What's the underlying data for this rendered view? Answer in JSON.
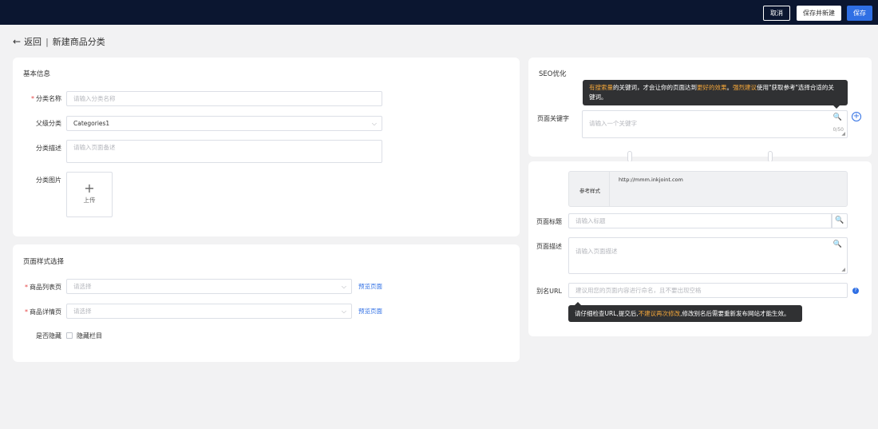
{
  "header": {
    "cancel": "取消",
    "save_new": "保存并新建",
    "save": "保存"
  },
  "nav": {
    "back": "返回",
    "separator": "|",
    "title": "新建商品分类"
  },
  "basic": {
    "title": "基本信息",
    "name_label": "分类名称",
    "name_placeholder": "请输入分类名称",
    "parent_label": "父级分类",
    "parent_value": "Categories1",
    "desc_label": "分类描述",
    "desc_placeholder": "请输入页面备述",
    "image_label": "分类图片",
    "upload_label": "上传"
  },
  "style": {
    "title": "页面样式选择",
    "list_label": "商品列表页",
    "list_placeholder": "请选择",
    "detail_label": "商品详情页",
    "detail_placeholder": "请选择",
    "preview_link": "预览页面",
    "hidden_label": "是否隐藏",
    "hidden_checkbox_label": "隐藏栏目"
  },
  "seo": {
    "title": "SEO优化",
    "tooltip": {
      "p1": "有搜索量",
      "p2": "的关键词，才会让你的页面达到",
      "p3": "更好的效果",
      "p4": "。",
      "p5": "强烈建议",
      "p6": "使用\"获取参考\"选择合适的关",
      "p7": "键词。"
    },
    "keyword_label": "页面关键字",
    "keyword_placeholder": "请输入一个关键字",
    "keyword_counter": "0/50",
    "ref_label": "参考样式",
    "ref_url": "http://mmm.inkjoint.com",
    "page_title_label": "页面标题",
    "page_title_placeholder": "请输入标题",
    "page_desc_label": "页面描述",
    "page_desc_placeholder": "请输入页面描述",
    "alias_label": "别名URL",
    "alias_placeholder": "建议用您的页面内容进行命名，且不要出现空格",
    "alias_tooltip": {
      "p1": "请仔细检查URL,提交后,",
      "p2": "不建议再次修改",
      "p3": ",修改别名后需要重新发布网站才能生效。"
    }
  },
  "colors": {
    "topbar": "#0b1630",
    "primary": "#2f6fe4",
    "highlight": "#f3a63a",
    "required": "#e54545"
  },
  "icons": [
    "arrow-left-icon",
    "chevron-down-icon",
    "plus-icon",
    "search-icon",
    "add-circle-icon",
    "help-icon"
  ]
}
